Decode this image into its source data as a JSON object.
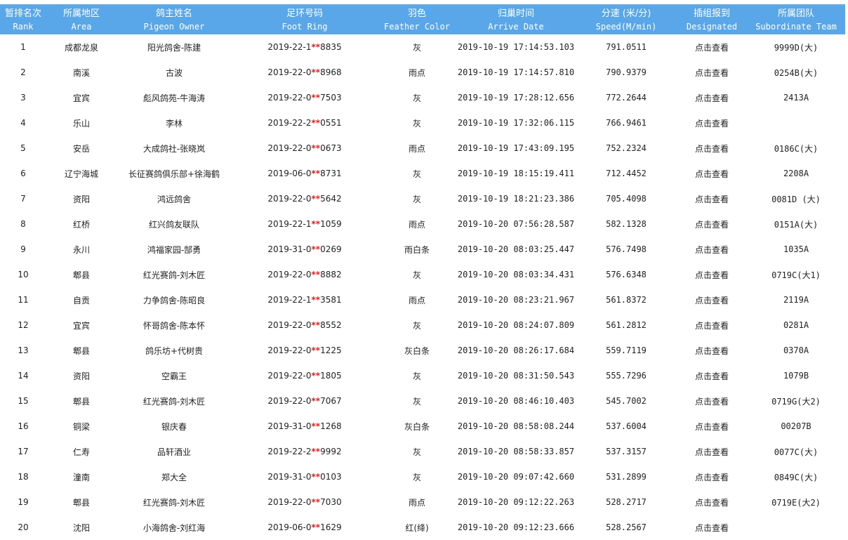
{
  "columns": [
    {
      "zh": "暂排名次",
      "en": "Rank"
    },
    {
      "zh": "所属地区",
      "en": "Area"
    },
    {
      "zh": "鸽主姓名",
      "en": "Pigeon Owner"
    },
    {
      "zh": "足环号码",
      "en": "Foot Ring"
    },
    {
      "zh": "羽色",
      "en": "Feather Color"
    },
    {
      "zh": "归巢时间",
      "en": "Arrive Date"
    },
    {
      "zh": "分速 (米/分)",
      "en": "Speed(M/min)"
    },
    {
      "zh": "插组报到",
      "en": "Designated"
    },
    {
      "zh": "所属团队",
      "en": "Subordinate Team"
    }
  ],
  "link_label": "点击查看",
  "ring_mask": "**",
  "colors": {
    "header_bg": "#59a7e9",
    "mask_red": "#e02020"
  },
  "rows": [
    {
      "rank": "1",
      "area": "成都龙泉",
      "owner": "阳光鸽舍-陈建",
      "ring_pre": "2019-22-1",
      "ring_suf": "8835",
      "color": "灰",
      "time": "2019-10-19 17:14:53.103",
      "speed": "791.0511",
      "team": "9999D(大)"
    },
    {
      "rank": "2",
      "area": "南溪",
      "owner": "古波",
      "ring_pre": "2019-22-0",
      "ring_suf": "8968",
      "color": "雨点",
      "time": "2019-10-19 17:14:57.810",
      "speed": "790.9379",
      "team": "0254B(大)"
    },
    {
      "rank": "3",
      "area": "宜宾",
      "owner": "彪风鸽苑-牛海涛",
      "ring_pre": "2019-22-0",
      "ring_suf": "7503",
      "color": "灰",
      "time": "2019-10-19 17:28:12.656",
      "speed": "772.2644",
      "team": "2413A"
    },
    {
      "rank": "4",
      "area": "乐山",
      "owner": "李林",
      "ring_pre": "2019-22-2",
      "ring_suf": "0551",
      "color": "灰",
      "time": "2019-10-19 17:32:06.115",
      "speed": "766.9461",
      "team": ""
    },
    {
      "rank": "5",
      "area": "安岳",
      "owner": "大成鸽社-张晓岚",
      "ring_pre": "2019-22-0",
      "ring_suf": "0673",
      "color": "雨点",
      "time": "2019-10-19 17:43:09.195",
      "speed": "752.2324",
      "team": "0186C(大)"
    },
    {
      "rank": "6",
      "area": "辽宁海城",
      "owner": "长征赛鸽俱乐部+徐海鹤",
      "ring_pre": "2019-06-0",
      "ring_suf": "8731",
      "color": "灰",
      "time": "2019-10-19 18:15:19.411",
      "speed": "712.4452",
      "team": "2208A"
    },
    {
      "rank": "7",
      "area": "资阳",
      "owner": "鸿远鸽舍",
      "ring_pre": "2019-22-0",
      "ring_suf": "5642",
      "color": "灰",
      "time": "2019-10-19 18:21:23.386",
      "speed": "705.4098",
      "team": "0081D (大)"
    },
    {
      "rank": "8",
      "area": "红桥",
      "owner": "红兴鸽友联队",
      "ring_pre": "2019-22-1",
      "ring_suf": "1059",
      "color": "雨点",
      "time": "2019-10-20 07:56:28.587",
      "speed": "582.1328",
      "team": "0151A(大)"
    },
    {
      "rank": "9",
      "area": "永川",
      "owner": "鸿福家园-郜勇",
      "ring_pre": "2019-31-0",
      "ring_suf": "0269",
      "color": "雨白条",
      "time": "2019-10-20 08:03:25.447",
      "speed": "576.7498",
      "team": "1035A"
    },
    {
      "rank": "10",
      "area": "郫县",
      "owner": "红光赛鸽-刘木匠",
      "ring_pre": "2019-22-0",
      "ring_suf": "8882",
      "color": "灰",
      "time": "2019-10-20 08:03:34.431",
      "speed": "576.6348",
      "team": "0719C(大1)"
    },
    {
      "rank": "11",
      "area": "自贡",
      "owner": "力争鸽舍-陈昭良",
      "ring_pre": "2019-22-1",
      "ring_suf": "3581",
      "color": "雨点",
      "time": "2019-10-20 08:23:21.967",
      "speed": "561.8372",
      "team": "2119A"
    },
    {
      "rank": "12",
      "area": "宜宾",
      "owner": "怀哥鸽舍-陈本怀",
      "ring_pre": "2019-22-0",
      "ring_suf": "8552",
      "color": "灰",
      "time": "2019-10-20 08:24:07.809",
      "speed": "561.2812",
      "team": "0281A"
    },
    {
      "rank": "13",
      "area": "郫县",
      "owner": "鸽乐坊+代树贵",
      "ring_pre": "2019-22-0",
      "ring_suf": "1225",
      "color": "灰白条",
      "time": "2019-10-20 08:26:17.684",
      "speed": "559.7119",
      "team": "0370A"
    },
    {
      "rank": "14",
      "area": "资阳",
      "owner": "空霸王",
      "ring_pre": "2019-22-0",
      "ring_suf": "1805",
      "color": "灰",
      "time": "2019-10-20 08:31:50.543",
      "speed": "555.7296",
      "team": "1079B"
    },
    {
      "rank": "15",
      "area": "郫县",
      "owner": "红光赛鸽-刘木匠",
      "ring_pre": "2019-22-0",
      "ring_suf": "7067",
      "color": "灰",
      "time": "2019-10-20 08:46:10.403",
      "speed": "545.7002",
      "team": "0719G(大2)"
    },
    {
      "rank": "16",
      "area": "铜梁",
      "owner": "银庆春",
      "ring_pre": "2019-31-0",
      "ring_suf": "1268",
      "color": "灰白条",
      "time": "2019-10-20 08:58:08.244",
      "speed": "537.6004",
      "team": "00207B"
    },
    {
      "rank": "17",
      "area": "仁寿",
      "owner": "品轩酒业",
      "ring_pre": "2019-22-2",
      "ring_suf": "9992",
      "color": "灰",
      "time": "2019-10-20 08:58:33.857",
      "speed": "537.3157",
      "team": "0077C(大)"
    },
    {
      "rank": "18",
      "area": "潼南",
      "owner": "郑大全",
      "ring_pre": "2019-31-0",
      "ring_suf": "0103",
      "color": "灰",
      "time": "2019-10-20 09:07:42.660",
      "speed": "531.2899",
      "team": "0849C(大)"
    },
    {
      "rank": "19",
      "area": "郫县",
      "owner": "红光赛鸽-刘木匠",
      "ring_pre": "2019-22-0",
      "ring_suf": "7030",
      "color": "雨点",
      "time": "2019-10-20 09:12:22.263",
      "speed": "528.2717",
      "team": "0719E(大2)"
    },
    {
      "rank": "20",
      "area": "沈阳",
      "owner": "小海鸽舍-刘红海",
      "ring_pre": "2019-06-0",
      "ring_suf": "1629",
      "color": "红(绛)",
      "time": "2019-10-20 09:12:23.666",
      "speed": "528.2567",
      "team": ""
    }
  ]
}
